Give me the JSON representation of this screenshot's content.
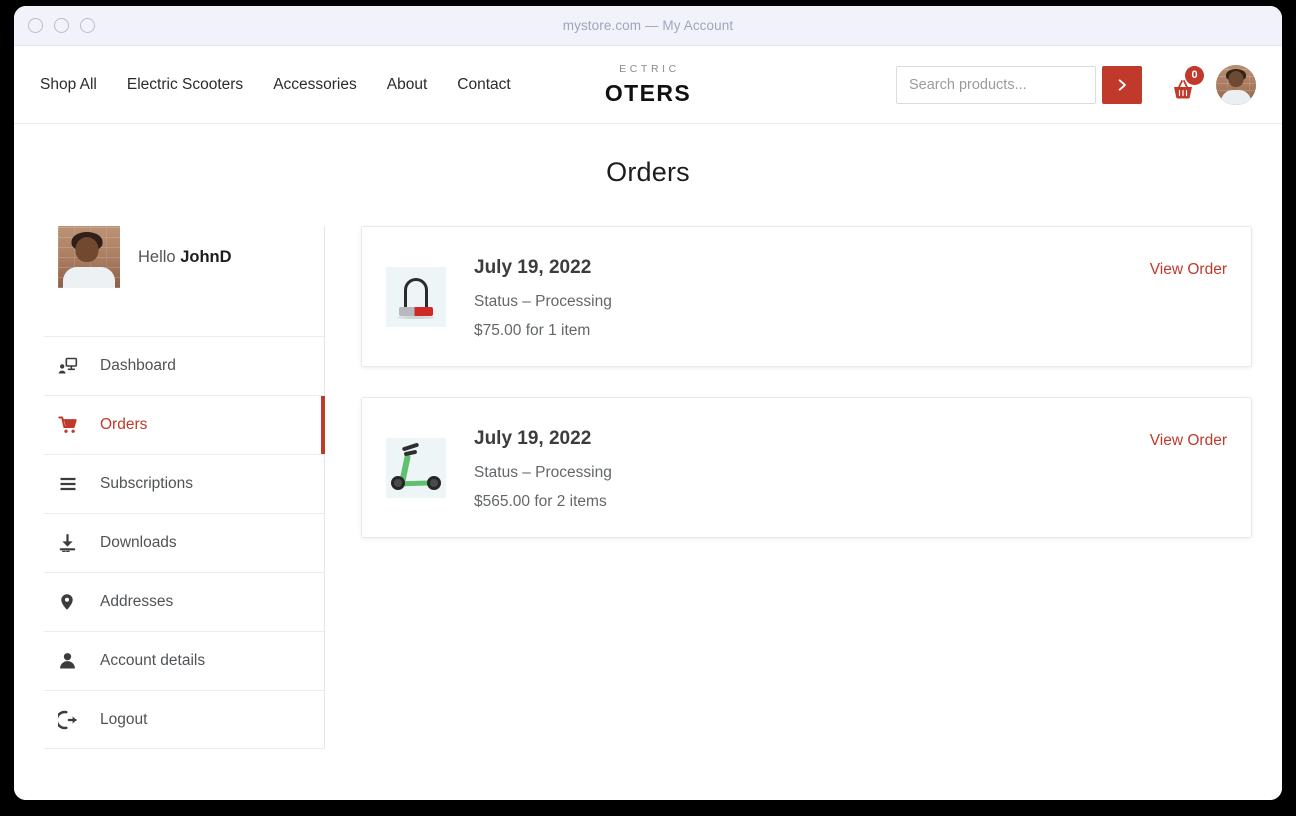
{
  "window": {
    "title": "mystore.com — My Account",
    "traffic_lights": [
      "close",
      "minimize",
      "maximize"
    ]
  },
  "header": {
    "nav": [
      {
        "label": "Shop All"
      },
      {
        "label": "Electric Scooters"
      },
      {
        "label": "Accessories"
      },
      {
        "label": "About"
      },
      {
        "label": "Contact"
      }
    ],
    "logo": {
      "top": "ECTRIC",
      "bottom": "OTERS"
    },
    "search": {
      "placeholder": "Search products...",
      "value": "",
      "submit_icon": "chevron-right-icon"
    },
    "cart": {
      "icon": "shopping-basket-icon",
      "count": "0"
    },
    "avatar": {
      "icon": "user-avatar-photo"
    }
  },
  "page": {
    "title": "Orders"
  },
  "sidebar": {
    "greeting_prefix": "Hello ",
    "username": "JohnD",
    "items": [
      {
        "label": "Dashboard",
        "icon": "dashboard-icon",
        "active": false
      },
      {
        "label": "Orders",
        "icon": "cart-icon",
        "active": true
      },
      {
        "label": "Subscriptions",
        "icon": "list-lines-icon",
        "active": false
      },
      {
        "label": "Downloads",
        "icon": "download-icon",
        "active": false
      },
      {
        "label": "Addresses",
        "icon": "map-pin-icon",
        "active": false
      },
      {
        "label": "Account details",
        "icon": "person-icon",
        "active": false
      },
      {
        "label": "Logout",
        "icon": "sign-out-icon",
        "active": false
      }
    ]
  },
  "orders": [
    {
      "date": "July 19, 2022",
      "status": "Status – Processing",
      "total": "$75.00 for 1 item",
      "action": "View Order",
      "thumb": "u-lock-product-image"
    },
    {
      "date": "July 19, 2022",
      "status": "Status – Processing",
      "total": "$565.00 for 2 items",
      "action": "View Order",
      "thumb": "electric-scooter-product-image"
    }
  ],
  "colors": {
    "accent_red": "#c0392b",
    "titlebar_bg": "#f2f3fa",
    "text_dark": "#1c1c1c",
    "text_muted": "#63676a"
  }
}
